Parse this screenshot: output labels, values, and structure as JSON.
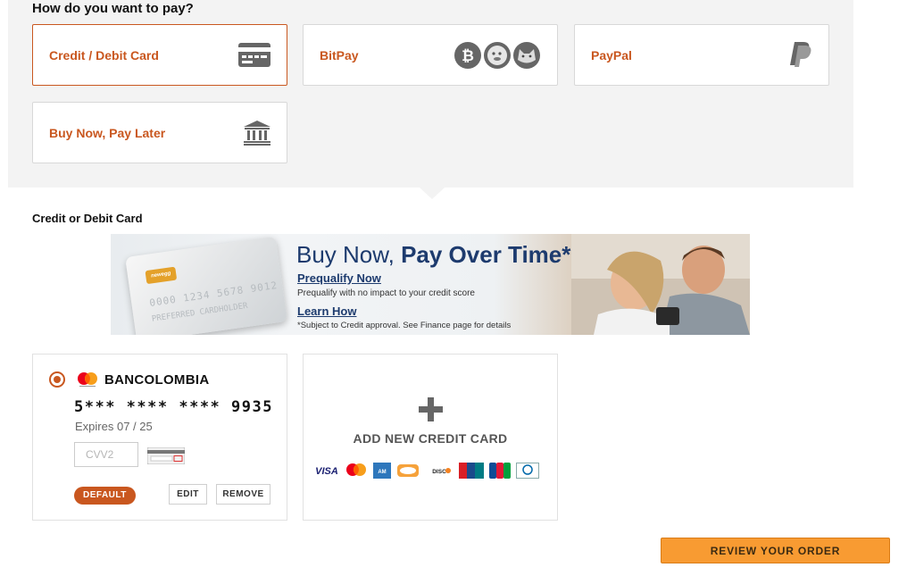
{
  "payment": {
    "title": "How do you want to pay?",
    "methods": [
      {
        "label": "Credit / Debit Card",
        "icon": "credit-card-icon",
        "selected": true
      },
      {
        "label": "BitPay",
        "icon": "crypto-coins-icon",
        "selected": false
      },
      {
        "label": "PayPal",
        "icon": "paypal-icon",
        "selected": false
      },
      {
        "label": "Buy Now, Pay Later",
        "icon": "bank-icon",
        "selected": false
      }
    ]
  },
  "section_label": "Credit or Debit Card",
  "banner": {
    "headline_light": "Buy Now,",
    "headline_bold": "Pay Over Time*",
    "prequalify_link": "Prequalify Now",
    "prequalify_text": "Prequalify with no impact to your credit score",
    "learn_link": "Learn How",
    "disclaimer": "*Subject to Credit approval. See Finance page for details",
    "card_brand": "newegg",
    "card_number": "0000 1234 5678 9012",
    "card_name": "PREFERRED CARDHOLDER"
  },
  "saved_card": {
    "bank": "BANCOLOMBIA",
    "number": "5*** **** **** 9935",
    "expires": "Expires 07 / 25",
    "cvv_placeholder": "CVV2",
    "badge": "DEFAULT",
    "edit_label": "EDIT",
    "remove_label": "REMOVE",
    "brand_icon": "mastercard-icon"
  },
  "add_card": {
    "label": "ADD NEW CREDIT CARD",
    "logos": [
      "visa-icon",
      "mastercard-icon",
      "amex-icon",
      "newegg-card-icon",
      "discover-icon",
      "unionpay-icon",
      "jcb-icon",
      "diners-club-icon"
    ]
  },
  "review_button": "REVIEW YOUR ORDER",
  "colors": {
    "accent": "#c9571f",
    "cta": "#f89b32",
    "banner_text": "#1d3b6e"
  }
}
